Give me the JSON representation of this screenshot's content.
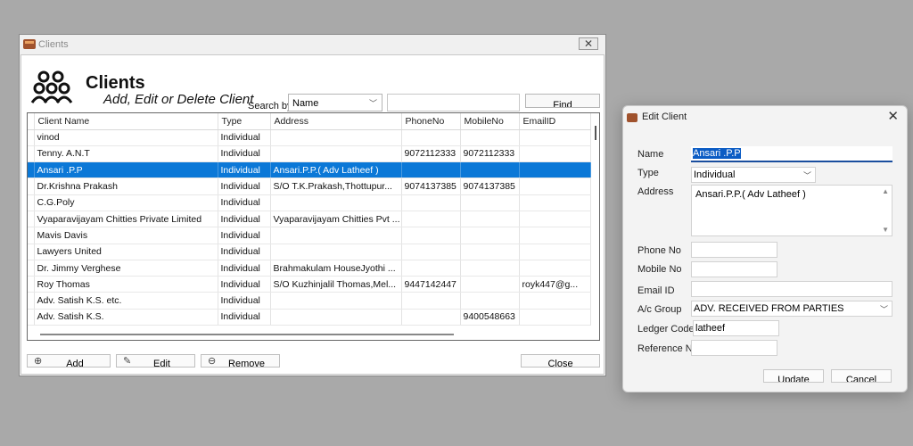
{
  "clients_window": {
    "title": "Clients",
    "close_glyph": "✕",
    "header_title": "Clients",
    "header_subtitle": "Add, Edit or Delete Client",
    "header_icon": "users-group-icon",
    "search_label": "Search by",
    "search_by_selected": "Name",
    "search_value": "",
    "find_label": "Find",
    "columns": [
      "Client Name",
      "Type",
      "Address",
      "PhoneNo",
      "MobileNo",
      "EmailID"
    ],
    "rows": [
      {
        "name": "vinod",
        "type": "Individual",
        "address": "",
        "phone": "",
        "mobile": "",
        "email": ""
      },
      {
        "name": "Tenny. A.N.T",
        "type": "Individual",
        "address": "",
        "phone": "9072112333",
        "mobile": "9072112333",
        "email": ""
      },
      {
        "name": "Ansari .P.P",
        "type": "Individual",
        "address": "Ansari.P.P.( Adv Latheef )",
        "phone": "",
        "mobile": "",
        "email": "",
        "selected": true
      },
      {
        "name": "Dr.Krishna Prakash",
        "type": "Individual",
        "address": "S/O T.K.Prakash,Thottupur...",
        "phone": "9074137385",
        "mobile": "9074137385",
        "email": ""
      },
      {
        "name": "C.G.Poly",
        "type": "Individual",
        "address": "",
        "phone": "",
        "mobile": "",
        "email": ""
      },
      {
        "name": "Vyaparavijayam Chitties Private Limited",
        "type": "Individual",
        "address": "Vyaparavijayam Chitties Pvt ...",
        "phone": "",
        "mobile": "",
        "email": ""
      },
      {
        "name": "Mavis Davis",
        "type": "Individual",
        "address": "",
        "phone": "",
        "mobile": "",
        "email": ""
      },
      {
        "name": "Lawyers United",
        "type": "Individual",
        "address": "",
        "phone": "",
        "mobile": "",
        "email": ""
      },
      {
        "name": " Dr. Jimmy Verghese",
        "type": "Individual",
        "address": "Brahmakulam HouseJyothi ...",
        "phone": "",
        "mobile": "",
        "email": ""
      },
      {
        "name": "Roy Thomas",
        "type": "Individual",
        "address": "S/O Kuzhinjalil Thomas,Mel...",
        "phone": "9447142447",
        "mobile": "",
        "email": "royk447@g..."
      },
      {
        "name": "Adv. Satish K.S. etc.",
        "type": "Individual",
        "address": "",
        "phone": "",
        "mobile": "",
        "email": ""
      },
      {
        "name": "Adv. Satish K.S.",
        "type": "Individual",
        "address": "",
        "phone": "",
        "mobile": "9400548663",
        "email": ""
      }
    ],
    "buttons": {
      "add": "Add",
      "edit": "Edit",
      "remove": "Remove",
      "close": "Close"
    }
  },
  "edit_dialog": {
    "title": "Edit Client",
    "close_glyph": "✕",
    "fields": {
      "name_label": "Name",
      "name_value": "Ansari .P.P",
      "type_label": "Type",
      "type_value": "Individual",
      "address_label": "Address",
      "address_value": "Ansari.P.P.( Adv Latheef )",
      "phone_label": "Phone No",
      "phone_value": "",
      "mobile_label": "Mobile No",
      "mobile_value": "",
      "email_label": "Email ID",
      "email_value": "",
      "acgroup_label": "A/c Group",
      "acgroup_value": "ADV. RECEIVED FROM PARTIES",
      "ledger_label": "Ledger Code",
      "ledger_value": "latheef",
      "reference_label": "Reference N",
      "reference_value": ""
    },
    "buttons": {
      "update": "Update",
      "cancel": "Cancel"
    }
  },
  "colors": {
    "selection": "#0b78d7",
    "desktop": "#a9a9a9",
    "focus_underline": "#1a4e9e"
  }
}
